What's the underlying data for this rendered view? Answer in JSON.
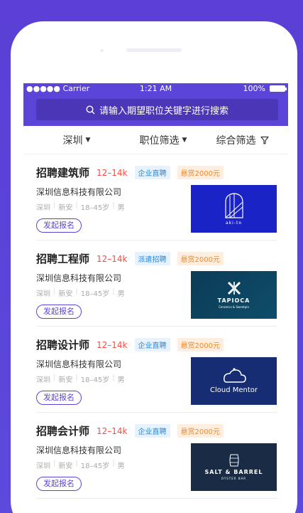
{
  "status_bar": {
    "carrier": "●●●●● Carrier",
    "time": "1:21 AM",
    "battery": "100%"
  },
  "search": {
    "placeholder": "请输入期望职位关键字进行搜索"
  },
  "filters": {
    "city": "深圳",
    "position": "职位筛选",
    "overall": "综合筛选"
  },
  "jobs": [
    {
      "title": "招聘建筑师",
      "salary": "12–14k",
      "type_tag": "企业直聘",
      "reward_tag": "悬赏2000元",
      "company": "深圳信息科技有限公司",
      "city": "深圳",
      "district": "新安",
      "age": "18–45岁",
      "gender": "男",
      "apply": "发起报名",
      "logo_name": "aki-to",
      "logo_color": "#1a23c6"
    },
    {
      "title": "招聘工程师",
      "salary": "12–14k",
      "type_tag": "派遣招聘",
      "reward_tag": "悬赏2000元",
      "company": "深圳信息科技有限公司",
      "city": "深圳",
      "district": "新安",
      "age": "18–45岁",
      "gender": "男",
      "apply": "发起报名",
      "logo_name": "TAPIOCA",
      "logo_sub": "Ceramics & Sweetpie",
      "logo_color": "#0c3b57"
    },
    {
      "title": "招聘设计师",
      "salary": "12–14k",
      "type_tag": "企业直聘",
      "reward_tag": "悬赏2000元",
      "company": "深圳信息科技有限公司",
      "city": "深圳",
      "district": "新安",
      "age": "18–45岁",
      "gender": "男",
      "apply": "发起报名",
      "logo_name": "Cloud Mentor",
      "logo_color": "#162d73"
    },
    {
      "title": "招聘会计师",
      "salary": "12–14k",
      "type_tag": "企业直聘",
      "reward_tag": "悬赏2000元",
      "company": "深圳信息科技有限公司",
      "city": "深圳",
      "district": "新安",
      "age": "18–45岁",
      "gender": "男",
      "apply": "发起报名",
      "logo_name": "SALT & BARREL",
      "logo_sub": "OYSTER BAR",
      "logo_color": "#1a2b46"
    }
  ]
}
